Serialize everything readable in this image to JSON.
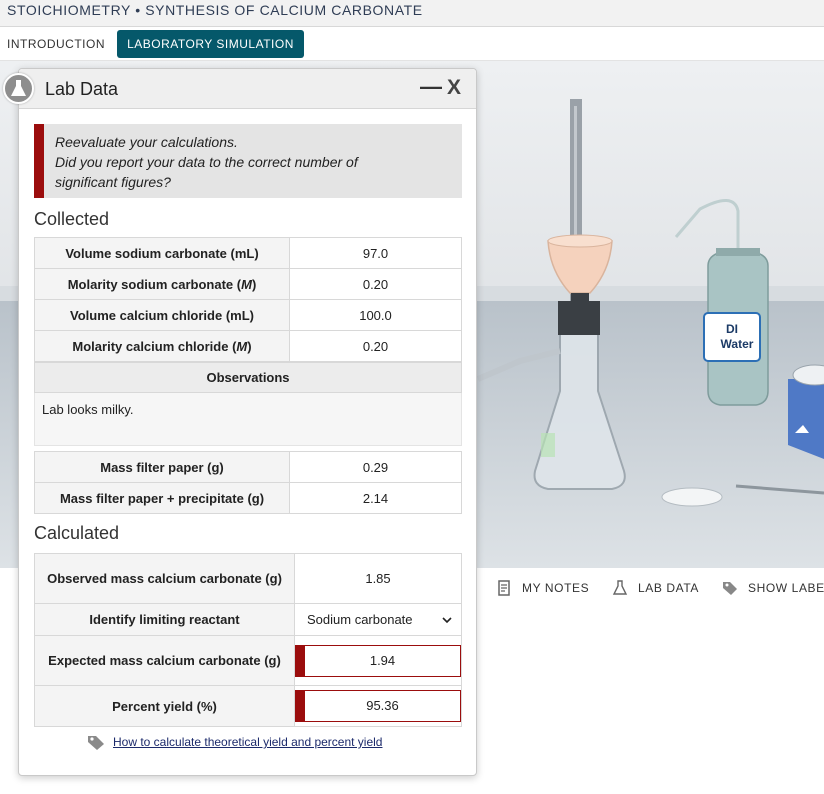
{
  "app": {
    "title": "STOICHIOMETRY • SYNTHESIS OF CALCIUM CARBONATE"
  },
  "tabs": [
    {
      "label": "INTRODUCTION",
      "active": false
    },
    {
      "label": "LABORATORY SIMULATION",
      "active": true
    }
  ],
  "scene": {
    "bottle_label_line1": "DI",
    "bottle_label_line2": "Water"
  },
  "toolbar": {
    "notes": {
      "label": "MY NOTES",
      "icon": "notes-icon"
    },
    "lab_data": {
      "label": "LAB DATA",
      "icon": "flask-icon"
    },
    "show_labels": {
      "label": "SHOW LABEL",
      "icon": "tag-icon"
    }
  },
  "dialog": {
    "title": "Lab Data",
    "minimize_label": "—",
    "close_label": "X",
    "feedback": {
      "line1": "Reevaluate your calculations.",
      "line2": "Did you report your data to the correct number of",
      "line3": "significant figures?"
    },
    "collected": {
      "heading": "Collected",
      "rows": [
        {
          "label": "Volume sodium carbonate (mL)",
          "value": "97.0"
        },
        {
          "label_pre": "Molarity sodium carbonate (",
          "label_unit": "M",
          "label_post": ")",
          "value": "0.20"
        },
        {
          "label": "Volume calcium chloride (mL)",
          "value": "100.0"
        },
        {
          "label_pre": "Molarity calcium chloride (",
          "label_unit": "M",
          "label_post": ")",
          "value": "0.20"
        }
      ],
      "observations_heading": "Observations",
      "observations_text": "Lab looks milky.",
      "mass_rows": [
        {
          "label": "Mass filter paper (g)",
          "value": "0.29"
        },
        {
          "label": "Mass filter paper + precipitate (g)",
          "value": "2.14"
        }
      ]
    },
    "calculated": {
      "heading": "Calculated",
      "observed_mass": {
        "label": "Observed mass calcium carbonate (g)",
        "value": "1.85"
      },
      "limiting_reactant": {
        "label": "Identify limiting reactant",
        "selected": "Sodium carbonate"
      },
      "expected_mass": {
        "label": "Expected mass calcium carbonate (g)",
        "value": "1.94"
      },
      "percent_yield": {
        "label": "Percent yield (%)",
        "value": "95.36"
      }
    },
    "help_link": "How to calculate theoretical yield and percent yield"
  },
  "colors": {
    "accent": "#05586a",
    "error": "#9b0d0d",
    "link": "#1c2a6b"
  }
}
